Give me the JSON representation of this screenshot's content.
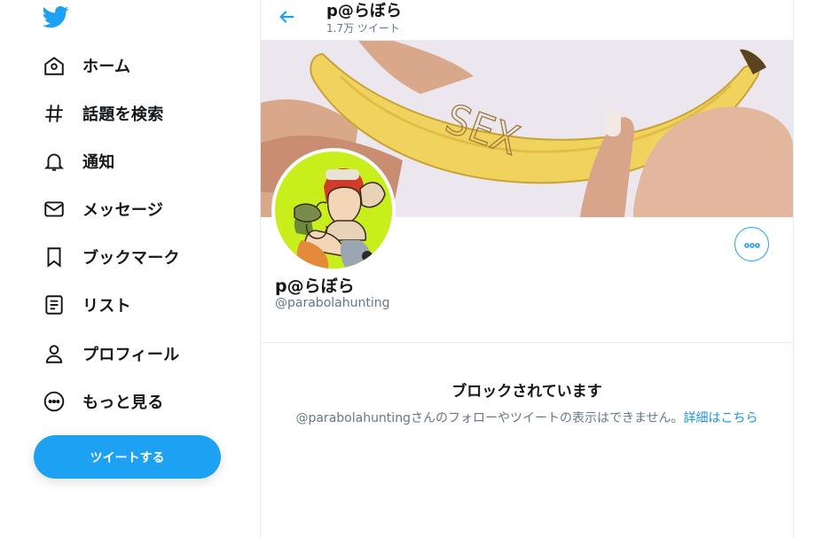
{
  "sidebar": {
    "items": [
      {
        "label": "ホーム",
        "icon": "home-icon"
      },
      {
        "label": "話題を検索",
        "icon": "hashtag-icon"
      },
      {
        "label": "通知",
        "icon": "bell-icon"
      },
      {
        "label": "メッセージ",
        "icon": "mail-icon"
      },
      {
        "label": "ブックマーク",
        "icon": "bookmark-icon"
      },
      {
        "label": "リスト",
        "icon": "list-icon"
      },
      {
        "label": "プロフィール",
        "icon": "person-icon"
      },
      {
        "label": "もっと見る",
        "icon": "more-circle-icon"
      }
    ],
    "tweet_button": "ツイートする"
  },
  "header": {
    "title": "p@らぼら",
    "tweet_count": "1.7万 ツイート"
  },
  "banner": {
    "text": "SEX"
  },
  "profile": {
    "name": "p@らぼら",
    "handle": "@parabolahunting"
  },
  "blocked": {
    "title": "ブロックされています",
    "message": "@parabolahuntingさんのフォローやツイートの表示はできません。",
    "link": "詳細はこちら"
  },
  "colors": {
    "accent": "#1da1f2",
    "link": "#1b95e0",
    "muted": "#657786"
  }
}
